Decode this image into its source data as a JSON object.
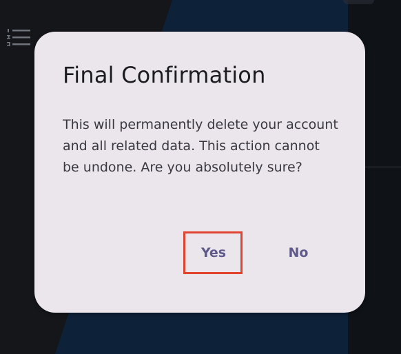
{
  "background": {
    "colors": {
      "left": "#141619",
      "center_panel": "#0d2139",
      "right_panel": "#0f1217"
    },
    "menu_icon": "numbered-list-icon"
  },
  "dialog": {
    "title": "Final Confirmation",
    "message": "This will permanently delete your account and all related data. This action cannot be undone. Are you absolutely sure?",
    "buttons": {
      "confirm_label": "Yes",
      "cancel_label": "No"
    },
    "highlighted_button": "Yes",
    "colors": {
      "surface": "#ebe6ec",
      "title_text": "#1c1b1f",
      "body_text": "#3a383f",
      "button_text": "#5e5a8a",
      "highlight_border": "#e2432e"
    }
  }
}
